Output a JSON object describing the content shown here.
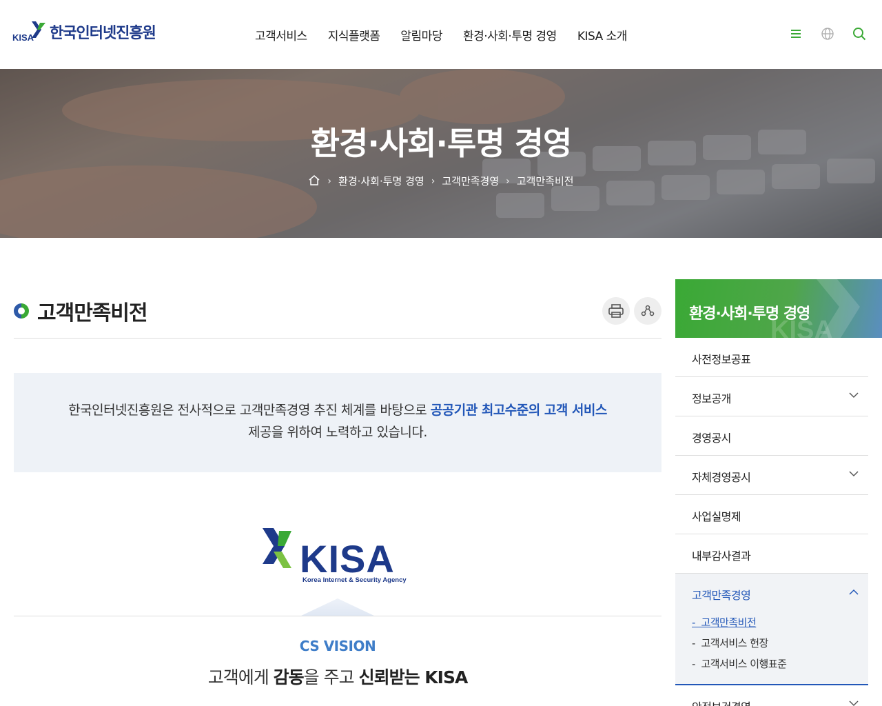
{
  "header": {
    "logo_text": "한국인터넷진흥원",
    "logo_abbr": "KISA",
    "nav": [
      "고객서비스",
      "지식플랫폼",
      "알림마당",
      "환경·사회·투명 경영",
      "KISA 소개"
    ],
    "icons": [
      "menu-icon",
      "globe-icon",
      "search-icon"
    ]
  },
  "hero": {
    "title": "환경·사회·투명 경영",
    "breadcrumb": [
      "환경·사회·투명 경영",
      "고객만족경영",
      "고객만족비전"
    ]
  },
  "main": {
    "page_title": "고객만족비전",
    "intro_before": "한국인터넷진흥원은 전사적으로 고객만족경영 추진 체계를 바탕으로 ",
    "intro_highlight": "공공기관 최고수준의 고객 서비스",
    "intro_after": "제공을 위하여 노력하고 있습니다.",
    "logo_big": "KISA",
    "logo_sub": "Korea Internet & Security Agency",
    "vision_label": "CS VISION",
    "vision_parts": [
      "고객에게 ",
      "감동",
      "을 주고 ",
      "신뢰받는",
      " KISA"
    ]
  },
  "lnb": {
    "title": "환경·사회·투명 경영",
    "watermark": "KISA",
    "items": [
      {
        "label": "사전정보공표",
        "expandable": false
      },
      {
        "label": "정보공개",
        "expandable": true
      },
      {
        "label": "경영공시",
        "expandable": false
      },
      {
        "label": "자체경영공시",
        "expandable": true
      },
      {
        "label": "사업실명제",
        "expandable": false
      },
      {
        "label": "내부감사결과",
        "expandable": false
      },
      {
        "label": "고객만족경영",
        "expandable": true,
        "open": true,
        "children": [
          "고객만족비전",
          "고객서비스 헌장",
          "고객서비스 이행표준"
        ]
      },
      {
        "label": "안전보건경영",
        "expandable": true
      }
    ]
  },
  "colors": {
    "brand_green": "#3aa935",
    "brand_blue": "#2257b8",
    "accent_light_blue": "#3e7dc8"
  }
}
